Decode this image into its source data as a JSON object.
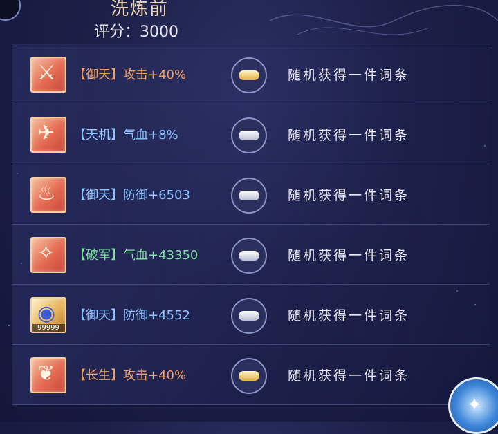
{
  "header": {
    "title": "洗炼前",
    "score": "评分：3000"
  },
  "colors": {
    "tag_orange": "#f0a060",
    "tag_blue": "#8ec4ff",
    "tag_green": "#7fe0a0",
    "value_orange": "#f0a060",
    "value_blue": "#8ec4ff",
    "value_green": "#7fe0a0"
  },
  "rows": [
    {
      "tag": "【御天】",
      "stat": "攻击+40%",
      "tag_color": "#f0a060",
      "stat_color": "#f0a060",
      "icon": "sword-icon",
      "lock": "gold-lock-icon",
      "random": "随机获得一件词条"
    },
    {
      "tag": "【天机】",
      "stat": "气血+8%",
      "tag_color": "#8ec4ff",
      "stat_color": "#8ec4ff",
      "icon": "bird-icon",
      "lock": "silver-lock-icon",
      "random": "随机获得一件词条"
    },
    {
      "tag": "【御天】",
      "stat": "防御+6503",
      "tag_color": "#8ec4ff",
      "stat_color": "#8ec4ff",
      "icon": "flame-icon",
      "lock": "silver-lock-icon",
      "random": "随机获得一件词条"
    },
    {
      "tag": "【破军】",
      "stat": "气血+43350",
      "tag_color": "#7fe0a0",
      "stat_color": "#7fe0a0",
      "icon": "boots-icon",
      "lock": "silver-lock-icon",
      "random": "随机获得一件词条"
    },
    {
      "tag": "【御天】",
      "stat": "防御+4552",
      "tag_color": "#8ec4ff",
      "stat_color": "#8ec4ff",
      "icon": "crystal-icon",
      "count": "99999",
      "lock": "silver-lock-icon",
      "random": "随机获得一件词条"
    },
    {
      "tag": "【长生】",
      "stat": "攻击+40%",
      "tag_color": "#f0a060",
      "stat_color": "#f0a060",
      "icon": "pendant-icon",
      "lock": "gold-lock-icon",
      "random": "随机获得一件词条"
    }
  ]
}
